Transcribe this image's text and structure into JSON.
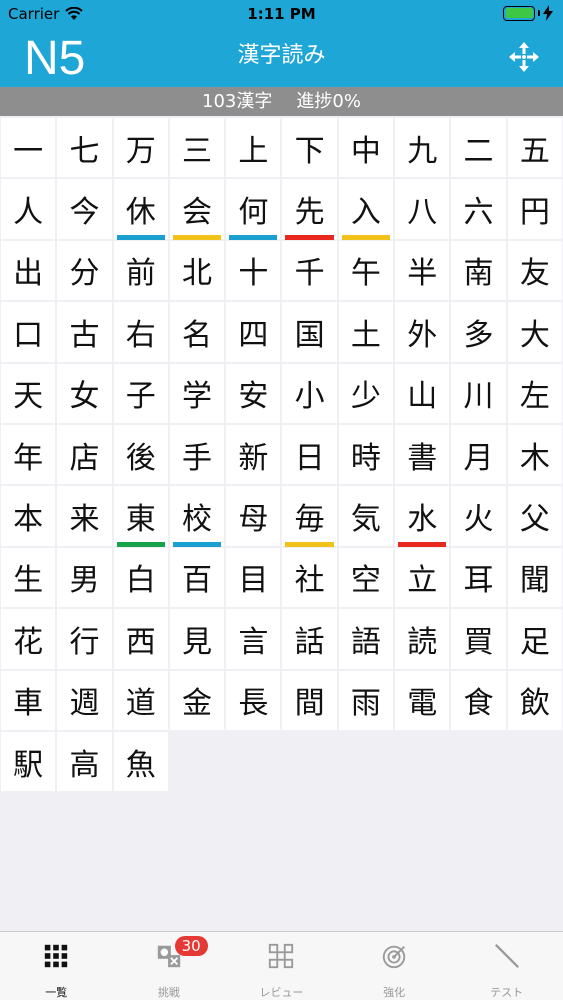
{
  "status": {
    "carrier": "Carrier",
    "time": "1:11 PM"
  },
  "nav": {
    "level": "N5",
    "title": "漢字読み",
    "action_icon": "move-arrows-icon"
  },
  "progress": {
    "count_label": "103漢字",
    "progress_label": "進捗0%"
  },
  "colors": {
    "header": "#1ea6d6",
    "mark_blue": "#1a9fd0",
    "mark_yellow": "#f2c21b",
    "mark_red": "#e8271e",
    "mark_green": "#17a24b"
  },
  "kanji": [
    {
      "k": "一"
    },
    {
      "k": "七"
    },
    {
      "k": "万"
    },
    {
      "k": "三"
    },
    {
      "k": "上"
    },
    {
      "k": "下"
    },
    {
      "k": "中"
    },
    {
      "k": "九"
    },
    {
      "k": "二"
    },
    {
      "k": "五"
    },
    {
      "k": "人"
    },
    {
      "k": "今"
    },
    {
      "k": "休",
      "m": "blue"
    },
    {
      "k": "会",
      "m": "yellow"
    },
    {
      "k": "何",
      "m": "blue"
    },
    {
      "k": "先",
      "m": "red"
    },
    {
      "k": "入",
      "m": "yellow"
    },
    {
      "k": "八"
    },
    {
      "k": "六"
    },
    {
      "k": "円"
    },
    {
      "k": "出"
    },
    {
      "k": "分"
    },
    {
      "k": "前"
    },
    {
      "k": "北"
    },
    {
      "k": "十"
    },
    {
      "k": "千"
    },
    {
      "k": "午"
    },
    {
      "k": "半"
    },
    {
      "k": "南"
    },
    {
      "k": "友"
    },
    {
      "k": "口"
    },
    {
      "k": "古"
    },
    {
      "k": "右"
    },
    {
      "k": "名"
    },
    {
      "k": "四"
    },
    {
      "k": "国"
    },
    {
      "k": "土"
    },
    {
      "k": "外"
    },
    {
      "k": "多"
    },
    {
      "k": "大"
    },
    {
      "k": "天"
    },
    {
      "k": "女"
    },
    {
      "k": "子"
    },
    {
      "k": "学"
    },
    {
      "k": "安"
    },
    {
      "k": "小"
    },
    {
      "k": "少"
    },
    {
      "k": "山"
    },
    {
      "k": "川"
    },
    {
      "k": "左"
    },
    {
      "k": "年"
    },
    {
      "k": "店"
    },
    {
      "k": "後"
    },
    {
      "k": "手"
    },
    {
      "k": "新"
    },
    {
      "k": "日"
    },
    {
      "k": "時"
    },
    {
      "k": "書"
    },
    {
      "k": "月"
    },
    {
      "k": "木"
    },
    {
      "k": "本"
    },
    {
      "k": "来"
    },
    {
      "k": "東",
      "m": "green"
    },
    {
      "k": "校",
      "m": "blue"
    },
    {
      "k": "母"
    },
    {
      "k": "毎",
      "m": "yellow"
    },
    {
      "k": "気"
    },
    {
      "k": "水",
      "m": "red"
    },
    {
      "k": "火"
    },
    {
      "k": "父"
    },
    {
      "k": "生"
    },
    {
      "k": "男"
    },
    {
      "k": "白"
    },
    {
      "k": "百"
    },
    {
      "k": "目"
    },
    {
      "k": "社"
    },
    {
      "k": "空"
    },
    {
      "k": "立"
    },
    {
      "k": "耳"
    },
    {
      "k": "聞"
    },
    {
      "k": "花"
    },
    {
      "k": "行"
    },
    {
      "k": "西"
    },
    {
      "k": "見"
    },
    {
      "k": "言"
    },
    {
      "k": "話"
    },
    {
      "k": "語"
    },
    {
      "k": "読"
    },
    {
      "k": "買"
    },
    {
      "k": "足"
    },
    {
      "k": "車"
    },
    {
      "k": "週"
    },
    {
      "k": "道"
    },
    {
      "k": "金"
    },
    {
      "k": "長"
    },
    {
      "k": "間"
    },
    {
      "k": "雨"
    },
    {
      "k": "電"
    },
    {
      "k": "食"
    },
    {
      "k": "飲"
    },
    {
      "k": "駅"
    },
    {
      "k": "高"
    },
    {
      "k": "魚"
    }
  ],
  "tabs": [
    {
      "label": "一覧",
      "icon": "grid-icon",
      "active": true
    },
    {
      "label": "挑戦",
      "icon": "challenge-icon",
      "badge": "30"
    },
    {
      "label": "レビュー",
      "icon": "review-icon"
    },
    {
      "label": "強化",
      "icon": "target-icon"
    },
    {
      "label": "テスト",
      "icon": "pencil-icon"
    }
  ]
}
